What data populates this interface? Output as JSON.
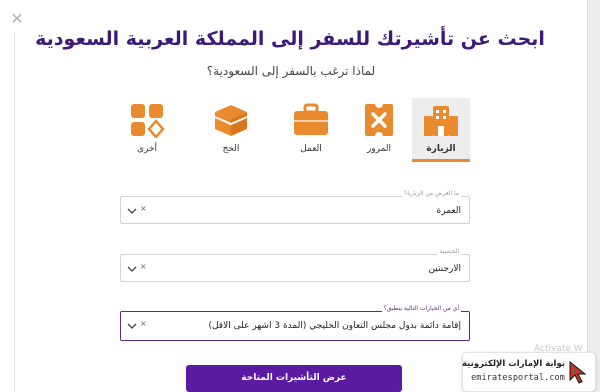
{
  "modal": {
    "title": "ابحث عن تأشيرتك للسفر إلى المملكة العربية السعودية",
    "subtitle": "لماذا ترغب بالسفر إلى السعودية؟"
  },
  "categories": [
    {
      "label": "الزيارة",
      "icon": "buildings-icon",
      "selected": true
    },
    {
      "label": "المرور",
      "icon": "ticket-icon",
      "selected": false
    },
    {
      "label": "العمل",
      "icon": "briefcase-icon",
      "selected": false
    },
    {
      "label": "الحج",
      "icon": "kaaba-icon",
      "selected": false
    },
    {
      "label": "أخرى",
      "icon": "grid-shapes-icon",
      "selected": false
    }
  ],
  "fields": {
    "purpose": {
      "label": "ما الغرض من الزيارة؟",
      "value": "العمرة"
    },
    "nationality": {
      "label": "الجنسية",
      "value": "الارجنتين"
    },
    "options": {
      "label": "أي من الخيارات التالية ينطبق؟",
      "value": "إقامة دائمة بدول مجلس التعاون الخليجي (المدة 3 اشهر على الاقل)"
    }
  },
  "submit_label": "عرض التأشيرات المتاحة",
  "watermark": "Activate W",
  "badge": {
    "arabic": "بوابة الإمارات الإلكترونية",
    "domain": "emiratesportal.com"
  },
  "colors": {
    "title": "#3c1a78",
    "accent_orange": "#e98a2f",
    "button": "#5a1aa1"
  }
}
